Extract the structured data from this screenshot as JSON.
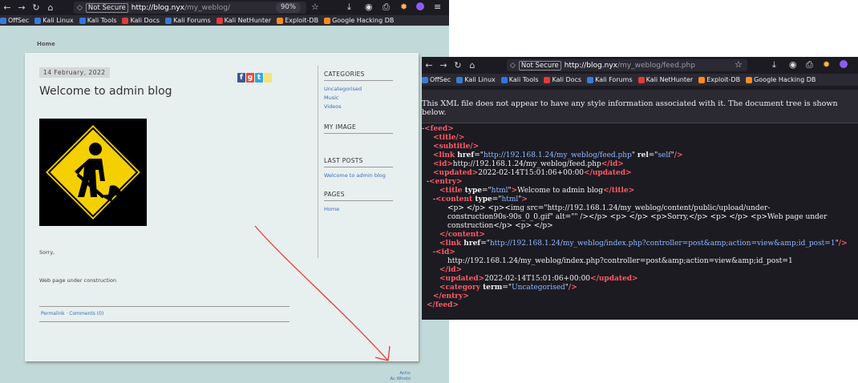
{
  "left_browser": {
    "url_not_secure": "Not Secure",
    "url_host": "http://blog.nyx",
    "url_path": "/my_weblog/",
    "zoom": "90%",
    "bookmarks": [
      "OffSec",
      "Kali Linux",
      "Kali Tools",
      "Kali Docs",
      "Kali Forums",
      "Kali NetHunter",
      "Exploit-DB",
      "Google Hacking DB"
    ],
    "breadcrumb": "Home",
    "post": {
      "date": "14 February, 2022",
      "title": "Welcome to admin blog",
      "text1": "Sorry,",
      "text2": "Web page under construction",
      "links": "Permalink · Comments (0)"
    },
    "sidebar": {
      "categories_heading": "CATEGORIES",
      "categories": [
        "Uncategorised",
        "Music",
        "Videos"
      ],
      "my_image_heading": "MY IMAGE",
      "last_posts_heading": "LAST POSTS",
      "last_posts": [
        "Welcome to admin blog"
      ],
      "pages_heading": "PAGES",
      "pages": [
        "Home"
      ]
    },
    "activate": [
      "Activ",
      "Ac Windo"
    ]
  },
  "right_browser": {
    "url_not_secure": "Not Secure",
    "url_host": "http://blog.nyx",
    "url_path": "/my_weblog/feed.php",
    "bookmarks": [
      "OffSec",
      "Kali Linux",
      "Kali Tools",
      "Kali Docs",
      "Kali Forums",
      "Kali NetHunter",
      "Exploit-DB",
      "Google Hacking DB"
    ],
    "xml_note": "This XML file does not appear to have any style information associated with it. The document tree is shown below.",
    "xml": {
      "link_href": "http://192.168.1.24/my_weblog/feed.php",
      "link_rel": "self",
      "id": "http://192.168.1.24/my_weblog/feed.php",
      "updated": "2022-02-14T15:01:06+00:00",
      "entry_title_type": "html",
      "entry_title": "Welcome to admin blog",
      "content_type": "html",
      "content_line1": "<p> </p> <p><img src=\"http://192.168.1.24/my_weblog/content/public/upload/under-",
      "content_line2": "construction90s-90s_0_0.gif\" alt=\"\" /></p> <p> </p> <p>Sorry,</p> <p> </p> <p>Web page under",
      "content_line3": "construction</p> <p> </p>",
      "entry_link_href": "http://192.168.1.24/my_weblog/index.php?controller=post&amp;action=view&amp;id_post=1",
      "entry_id": "http://192.168.1.24/my_weblog/index.php?controller=post&amp;action=view&amp;id_post=1",
      "entry_updated": "2022-02-14T15:01:06+00:00",
      "category_term": "Uncategorised"
    }
  },
  "colors": {
    "xml_tag": "#ff5a67",
    "xml_attr_value": "#8db9ff",
    "annotation_arrow": "#e83a3a",
    "blog_background": "#c2d9d9"
  }
}
